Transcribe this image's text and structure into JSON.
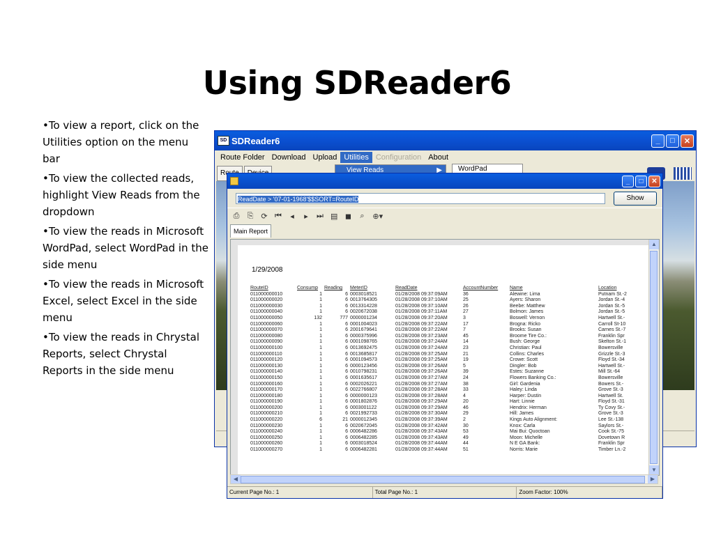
{
  "slide": {
    "title": "Using SDReader6",
    "bullets": [
      "•To view a report, click on the Utilities option on the menu bar",
      "•To view the collected reads, highlight View Reads from the dropdown",
      "•To view the reads in Microsoft WordPad, select WordPad in the side menu",
      "•To view the reads in Microsoft Excel, select Excel in the side menu",
      "•To view the reads in Chrystal Reports, select Chrystal Reports in the side menu"
    ]
  },
  "app": {
    "title": "SDReader6",
    "menu": [
      "Route Folder",
      "Download",
      "Upload",
      "Utilities",
      "Configuration",
      "About"
    ],
    "dropdown_item": "View Reads",
    "submenu_item": "WordPad",
    "toolbar": [
      "Route",
      "Device"
    ]
  },
  "report": {
    "filter": "ReadDate > '07-01-1968'$$SORT=RouteID",
    "show_label": "Show",
    "tab": "Main Report",
    "date": "1/29/2008",
    "columns": [
      "RouteID",
      "Consump",
      "Reading",
      "MeterID",
      "ReadDate",
      "AccountNumber",
      "Name",
      "Location"
    ],
    "rows": [
      [
        "011000000010",
        "1",
        "6",
        "0003018521",
        "01/28/2008  09:37:09AM",
        "36",
        "Alewine: Lima",
        "Putnam St.-2"
      ],
      [
        "011000000020",
        "1",
        "6",
        "0013764305",
        "01/28/2008  09:37:10AM",
        "25",
        "Ayers: Sharon",
        "Jordan St.-4"
      ],
      [
        "011000000030",
        "1",
        "6",
        "0013314228",
        "01/28/2008  09:37:10AM",
        "26",
        "Beebe: Matthew",
        "Jordan St.-5"
      ],
      [
        "011000000040",
        "1",
        "6",
        "0020672038",
        "01/28/2008  09:37:11AM",
        "27",
        "Bolmon: James",
        "Jordan St.-5"
      ],
      [
        "011000000050",
        "132",
        "777",
        "0000001234",
        "01/28/2008  09:37:20AM",
        "3",
        "Boswell: Vernon",
        "Hartwell St.-"
      ],
      [
        "011000000060",
        "1",
        "6",
        "0001004023",
        "01/28/2008  09:37:22AM",
        "17",
        "Brogna: Ricko",
        "Carroll St-10"
      ],
      [
        "011000000070",
        "1",
        "6",
        "2001679641",
        "01/28/2008  09:37:22AM",
        "7",
        "Brooks: Susan",
        "Carnes St.-7"
      ],
      [
        "011000000080",
        "1",
        "6",
        "0000375996",
        "01/28/2008  09:37:23AM",
        "45",
        "Broome Tire Co.:",
        "Franklin Spr"
      ],
      [
        "011000000090",
        "1",
        "6",
        "0001098765",
        "01/28/2008  09:37:24AM",
        "14",
        "Bush: George",
        "Skelton St.-1"
      ],
      [
        "011000000100",
        "1",
        "6",
        "0013692475",
        "01/28/2008  09:37:24AM",
        "23",
        "Christian: Paul",
        "Bowersville"
      ],
      [
        "011000000110",
        "1",
        "6",
        "0013685817",
        "01/28/2008  09:37:25AM",
        "21",
        "Collins: Charles",
        "Grizzle St.-3"
      ],
      [
        "011000000120",
        "1",
        "6",
        "0001094573",
        "01/28/2008  09:37:25AM",
        "19",
        "Crowe: Scott",
        "Floyd St.-34"
      ],
      [
        "011000000130",
        "1",
        "6",
        "0000123456",
        "01/28/2008  09:37:26AM",
        "5",
        "Dingler: Bob",
        "Hartwell St.-"
      ],
      [
        "011000000140",
        "1",
        "6",
        "0010798231",
        "01/28/2008  09:37:26AM",
        "39",
        "Estes: Suzanne",
        "Mill St.-64"
      ],
      [
        "011000000150",
        "1",
        "6",
        "0001635617",
        "01/28/2008  09:37:27AM",
        "24",
        "Flowers Banking Co.:",
        "Bowersville"
      ],
      [
        "011000000160",
        "1",
        "6",
        "0002026221",
        "01/28/2008  09:37:27AM",
        "38",
        "Girl: Gardenia",
        "Bowers St.-"
      ],
      [
        "011000000170",
        "1",
        "6",
        "0022766807",
        "01/28/2008  09:37:28AM",
        "33",
        "Haley: Linda",
        "Grove St.-3"
      ],
      [
        "011000000180",
        "1",
        "6",
        "0000000123",
        "01/28/2008  09:37:28AM",
        "4",
        "Harper: Dustin",
        "Hartwell St."
      ],
      [
        "011000000190",
        "1",
        "6",
        "0001802876",
        "01/28/2008  09:37:29AM",
        "20",
        "Hart: Linnie",
        "Floyd St.-31"
      ],
      [
        "011000000200",
        "1",
        "6",
        "0003001122",
        "01/28/2008  09:37:29AM",
        "46",
        "Hendrix: Herman",
        "Ty Covy St.-"
      ],
      [
        "011000000210",
        "1",
        "6",
        "0021992733",
        "01/28/2008  09:37:30AM",
        "29",
        "Hill: James",
        "Grove St.-3"
      ],
      [
        "011000000220",
        "6",
        "21",
        "0000012345",
        "01/28/2008  09:37:39AM",
        "2",
        "Kings Auto Alignment:",
        "Lee St.-138"
      ],
      [
        "011000000230",
        "1",
        "6",
        "0020672045",
        "01/28/2008  09:37:42AM",
        "30",
        "Knox: Carla",
        "Saylors St.-"
      ],
      [
        "011000000240",
        "1",
        "6",
        "0006482286",
        "01/28/2008  09:37:43AM",
        "53",
        "Mai Bui: Quoctoan",
        "Cook St.-75"
      ],
      [
        "011000000250",
        "1",
        "6",
        "0006482285",
        "01/28/2008  09:37:43AM",
        "49",
        "Moon: Michelle",
        "Dovetown R"
      ],
      [
        "011000000260",
        "1",
        "6",
        "0003018524",
        "01/28/2008  09:37:44AM",
        "44",
        "N E GA Bank:",
        "Franklin Spr"
      ],
      [
        "011000000270",
        "1",
        "6",
        "0006482281",
        "01/28/2008  09:37:44AM",
        "51",
        "Norris: Marie",
        "Timber Ln.-2"
      ]
    ],
    "status": {
      "current_page": "Current Page No.: 1",
      "total_page": "Total Page No.: 1",
      "zoom": "Zoom Factor: 100%"
    }
  }
}
